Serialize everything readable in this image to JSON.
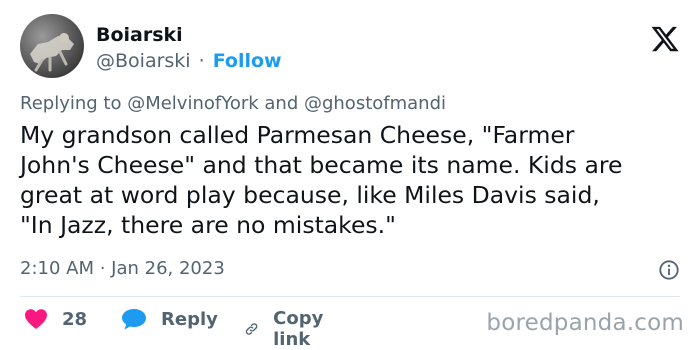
{
  "tweet": {
    "author": {
      "name": "Boiarski",
      "handle": "@Boiarski",
      "separator": "·",
      "follow_label": "Follow"
    },
    "reply_to": "Replying to @MelvinofYork and @ghostofmandi",
    "text": "My grandson called Parmesan Cheese, \"Farmer\nJohn's Cheese\" and that became its name. Kids are\ngreat at word play because, like Miles Davis said,\n\"In Jazz, there are no mistakes.\"",
    "timestamp": "2:10 AM · Jan 26, 2023",
    "actions": {
      "likes": "28",
      "reply_label": "Reply",
      "copy_link_label": "Copy link"
    }
  },
  "watermark": "boredpanda.com",
  "colors": {
    "accent": "#1d9bf0",
    "like": "#f91880",
    "secondary_text": "#536471",
    "primary_text": "#0f1419"
  },
  "icons": [
    "x-logo-icon",
    "info-icon",
    "heart-icon",
    "reply-bubble-icon",
    "link-icon"
  ]
}
